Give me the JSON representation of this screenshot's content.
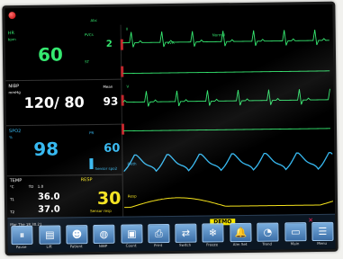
{
  "top": {
    "lead": "Abc"
  },
  "ecg": {
    "hr_label": "HR",
    "hr_unit": "bpm",
    "hr_value": "60",
    "pvcs_label": "PVCs",
    "pvcs_value": "2",
    "st_label": "ST",
    "lead_labels": [
      "II",
      "aVR",
      "V"
    ],
    "annotation": "Normal"
  },
  "nibp": {
    "label": "NIBP",
    "unit": "mmHg",
    "value": "120/ 80",
    "mean_label": "Mean",
    "mean_value": "93"
  },
  "spo2": {
    "label": "SPO2",
    "unit": "%",
    "value": "98",
    "pr_label": "PR",
    "pr_value": "60",
    "sensor_label": "Sensor spo2"
  },
  "temp": {
    "label": "TEMP",
    "unit": "°C",
    "t1_label": "T1",
    "t1_value": "36.0",
    "t2_label": "T2",
    "t2_value": "37.0",
    "td_label": "TD",
    "td_value": "1.0"
  },
  "resp": {
    "label": "RESP",
    "value": "30",
    "sensor_label": "Sensor resp"
  },
  "wave_labels": {
    "pleth": "Pleth",
    "resp": "Resp"
  },
  "status": {
    "date": "Mar The 18.30.21",
    "demo": "DEMO"
  },
  "toolbar": {
    "buttons": [
      {
        "label": "Pause",
        "glyph": "⏸"
      },
      {
        "label": "Lift",
        "glyph": "▤"
      },
      {
        "label": "Patient",
        "glyph": "☻"
      },
      {
        "label": "NIBP",
        "glyph": "◍"
      },
      {
        "label": "Count",
        "glyph": "▣"
      },
      {
        "label": "Print",
        "glyph": "⎙"
      },
      {
        "label": "Switch",
        "glyph": "⇄"
      },
      {
        "label": "Freeze",
        "glyph": "❄"
      },
      {
        "label": "Alm Set",
        "glyph": "🔔"
      },
      {
        "label": "Trend",
        "glyph": "◔"
      },
      {
        "label": "Main",
        "glyph": "▭"
      },
      {
        "label": "Menu",
        "glyph": "☰"
      }
    ]
  },
  "colors": {
    "ecg": "#35e870",
    "nibp": "#ffffff",
    "spo2": "#37b9f1",
    "resp": "#f5e31c",
    "temp": "#ffffff",
    "accent_red": "#c2272d"
  }
}
